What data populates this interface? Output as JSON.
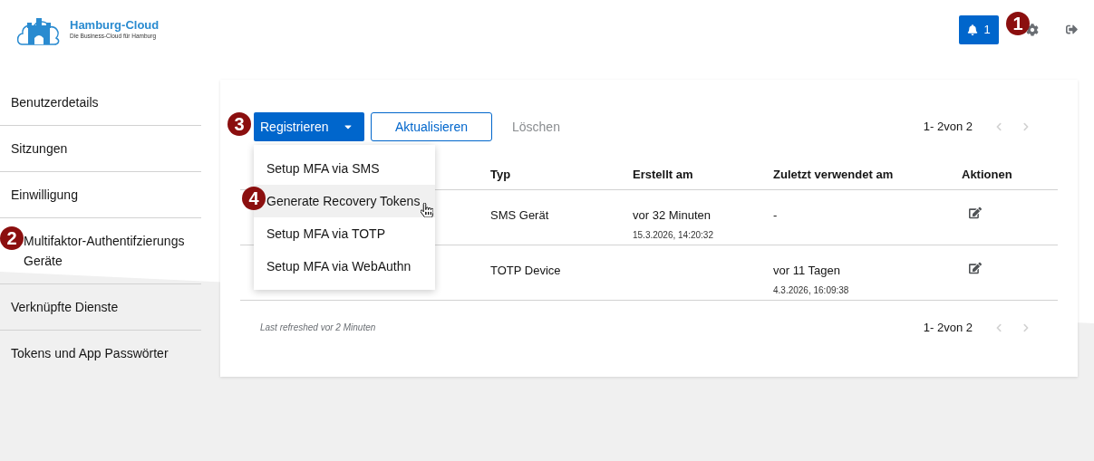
{
  "header": {
    "logo": {
      "title": "Hamburg-Cloud",
      "subtitle": "Die Business-Cloud für Hamburg"
    },
    "notifications": {
      "count": "1"
    }
  },
  "sidebar": {
    "items": [
      {
        "label": "Benutzerdetails"
      },
      {
        "label": "Sitzungen"
      },
      {
        "label": "Einwilligung"
      },
      {
        "label": "Multifaktor-Authentifzierungs Geräte"
      },
      {
        "label": "Verknüpfte Dienste"
      },
      {
        "label": "Tokens und App Passwörter"
      }
    ]
  },
  "toolbar": {
    "register": "Registrieren",
    "refresh": "Aktualisieren",
    "delete": {
      "label": "Löschen",
      "disabled": true
    },
    "pagination": "1- 2von 2"
  },
  "dropdown": {
    "items": [
      {
        "label": "Setup MFA via SMS",
        "selected": false
      },
      {
        "label": "Generate Recovery Tokens",
        "selected": true
      },
      {
        "label": "Setup MFA via TOTP",
        "selected": false
      },
      {
        "label": "Setup MFA via WebAuthn",
        "selected": false
      }
    ]
  },
  "table": {
    "columns": [
      "Typ",
      "Erstellt am",
      "Zuletzt verwendet am",
      "Aktionen"
    ],
    "rows": [
      {
        "type": "SMS Gerät",
        "created": "vor 32 Minuten",
        "created_date": "15.3.2026, 14:20:32",
        "last_used": "-",
        "last_used_date": null
      },
      {
        "type": "TOTP Device",
        "created": null,
        "created_date": null,
        "last_used": "vor 11 Tagen",
        "last_used_date": "4.3.2026, 16:09:38"
      }
    ]
  },
  "footer": {
    "refreshed": "Last refreshed vor 2 Minuten",
    "pagination": "1- 2von 2"
  },
  "callouts": [
    "1",
    "2",
    "3",
    "4"
  ]
}
